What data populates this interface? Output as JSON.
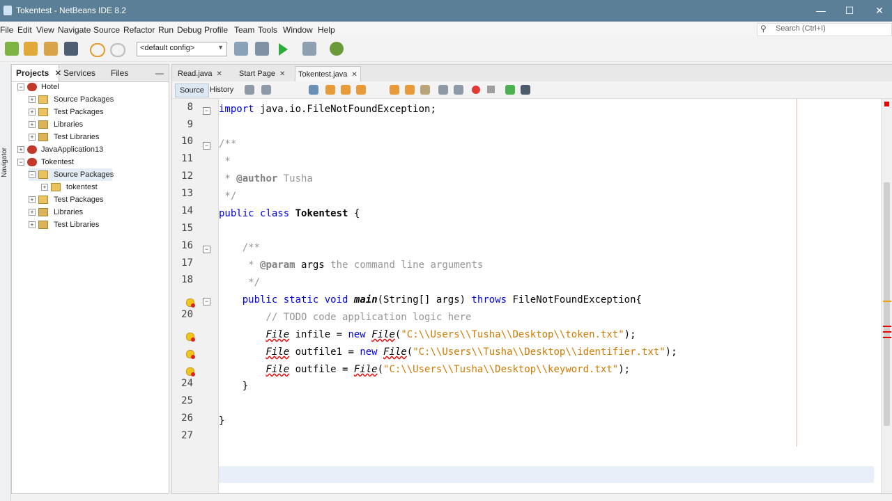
{
  "window": {
    "title": "Tokentest - NetBeans IDE 8.2"
  },
  "menu": [
    "File",
    "Edit",
    "View",
    "Navigate",
    "Source",
    "Refactor",
    "Run",
    "Debug",
    "Profile",
    "Team",
    "Tools",
    "Window",
    "Help"
  ],
  "search": {
    "placeholder": "Search (Ctrl+I)"
  },
  "toolbar": {
    "config": "<default config>"
  },
  "navigator_label": "Navigator",
  "project_tabs": [
    "Projects",
    "Services",
    "Files"
  ],
  "tree": [
    {
      "label": "Hotel",
      "level": 0,
      "type": "proj"
    },
    {
      "label": "Source Packages",
      "level": 1,
      "type": "pkg"
    },
    {
      "label": "Test Packages",
      "level": 1,
      "type": "pkg"
    },
    {
      "label": "Libraries",
      "level": 1,
      "type": "lib"
    },
    {
      "label": "Test Libraries",
      "level": 1,
      "type": "lib"
    },
    {
      "label": "JavaApplication13",
      "level": 0,
      "type": "proj"
    },
    {
      "label": "Tokentest",
      "level": 0,
      "type": "proj"
    },
    {
      "label": "Source Packages",
      "level": 1,
      "type": "pkg"
    },
    {
      "label": "tokentest",
      "level": 2,
      "type": "pkg"
    },
    {
      "label": "Test Packages",
      "level": 1,
      "type": "pkg"
    },
    {
      "label": "Libraries",
      "level": 1,
      "type": "lib"
    },
    {
      "label": "Test Libraries",
      "level": 1,
      "type": "lib"
    }
  ],
  "editor_tabs": [
    {
      "label": "Read.java"
    },
    {
      "label": "Start Page"
    },
    {
      "label": "Tokentest.java"
    }
  ],
  "editor_toolbar": {
    "source": "Source",
    "history": "History"
  },
  "line_numbers": [
    "8",
    "9",
    "10",
    "11",
    "12",
    "13",
    "14",
    "15",
    "16",
    "17",
    "18",
    "",
    "20",
    "",
    "",
    "",
    "24",
    "25",
    "26",
    "27"
  ],
  "code": {
    "l8_a": "import",
    "l8_b": " java.io.FileNotFoundException;",
    "l10": "/**",
    "l11": " *",
    "l12_a": " * ",
    "l12_b": "@author",
    "l12_c": " Tusha",
    "l13": " */",
    "l14_a": "public",
    "l14_b": " ",
    "l14_c": "class",
    "l14_d": " ",
    "l14_e": "Tokentest",
    "l14_f": " {",
    "l16": "    /**",
    "l17_a": "     * ",
    "l17_b": "@param",
    "l17_c": " args",
    "l17_d": " the command line arguments",
    "l18": "     */",
    "l19_a": "    ",
    "l19_b": "public",
    "l19_c": " ",
    "l19_d": "static",
    "l19_e": " ",
    "l19_f": "void",
    "l19_g": " ",
    "l19_h": "main",
    "l19_i": "(String[] args) ",
    "l19_j": "throws",
    "l19_k": " FileNotFoundException{",
    "l20": "        // TODO code application logic here",
    "l21_a": "        ",
    "l21_b": "File",
    "l21_c": " infile = ",
    "l21_d": "new",
    "l21_e": " ",
    "l21_f": "File",
    "l21_g": "(",
    "l21_h": "\"C:\\\\Users\\\\Tusha\\\\Desktop\\\\token.txt\"",
    "l21_i": ");",
    "l22_a": "        ",
    "l22_b": "File",
    "l22_c": " outfile1 = ",
    "l22_d": "new",
    "l22_e": " ",
    "l22_f": "File",
    "l22_g": "(",
    "l22_h": "\"C:\\\\Users\\\\Tusha\\\\Desktop\\\\identifier.txt\"",
    "l22_i": ");",
    "l23_a": "        ",
    "l23_b": "File",
    "l23_c": " outfile = ",
    "l23_d": "File",
    "l23_e": "(",
    "l23_f": "\"C:\\\\Users\\\\Tusha\\\\Desktop\\\\keyword.txt\"",
    "l23_g": ");",
    "l24": "    }",
    "l26": "}"
  }
}
